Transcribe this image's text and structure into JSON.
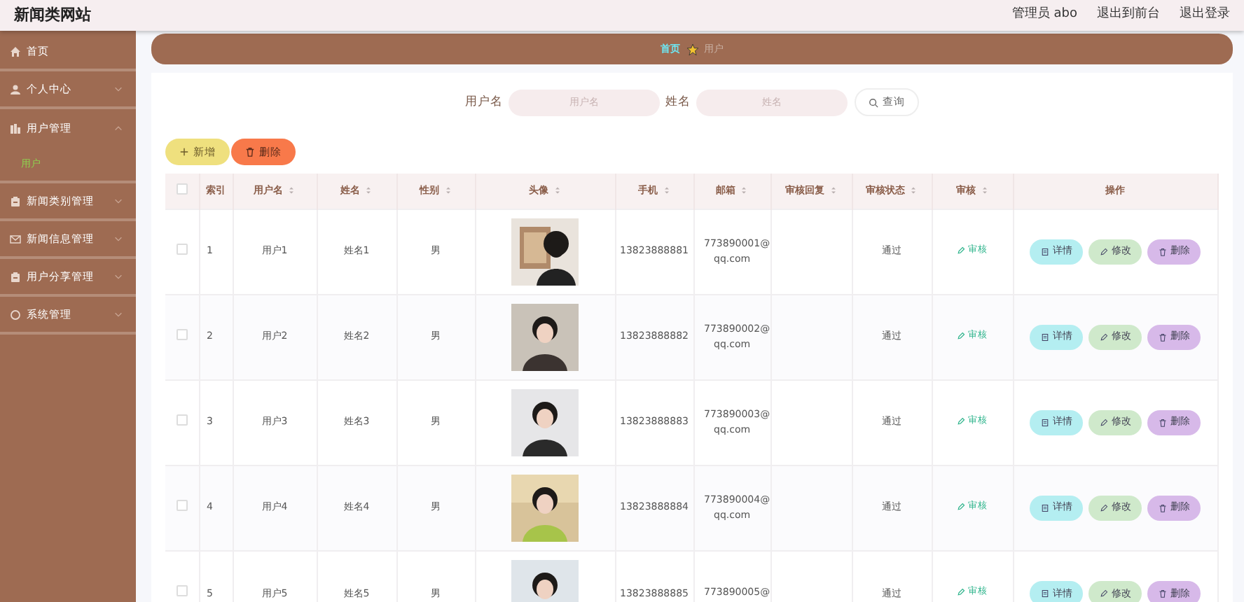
{
  "header": {
    "title": "新闻类网站",
    "links": [
      "管理员 abo",
      "退出到前台",
      "退出登录"
    ]
  },
  "sidebar": {
    "items": [
      {
        "label": "首页",
        "kind": "link"
      },
      {
        "label": "个人中心",
        "kind": "menu",
        "expanded": false
      },
      {
        "label": "用户管理",
        "kind": "menu",
        "expanded": true,
        "children": [
          {
            "label": "用户",
            "selected": true
          }
        ]
      },
      {
        "label": "新闻类别管理",
        "kind": "menu",
        "expanded": false
      },
      {
        "label": "新闻信息管理",
        "kind": "menu",
        "expanded": false
      },
      {
        "label": "用户分享管理",
        "kind": "menu",
        "expanded": false
      },
      {
        "label": "系统管理",
        "kind": "menu",
        "expanded": false
      }
    ]
  },
  "breadcrumb": [
    "首页",
    "用户"
  ],
  "search": {
    "fields": [
      {
        "label": "用户名",
        "placeholder": "用户名"
      },
      {
        "label": "姓名",
        "placeholder": "姓名"
      }
    ],
    "button": "查询"
  },
  "toolbar": [
    {
      "kind": "add",
      "label": "新增"
    },
    {
      "kind": "delete",
      "label": "删除"
    }
  ],
  "table": {
    "select_all": {
      "checked": false
    },
    "columns": [
      {
        "label": "索引",
        "sortable": false
      },
      {
        "label": "用户名",
        "sortable": true
      },
      {
        "label": "姓名",
        "sortable": true
      },
      {
        "label": "性别",
        "sortable": true
      },
      {
        "label": "头像",
        "sortable": true
      },
      {
        "label": "手机",
        "sortable": true
      },
      {
        "label": "邮箱",
        "sortable": true
      },
      {
        "label": "审核回复",
        "sortable": true
      },
      {
        "label": "审核状态",
        "sortable": true
      },
      {
        "label": "审核",
        "sortable": true
      },
      {
        "label": "操作",
        "sortable": false
      }
    ],
    "rows": [
      {
        "checked": false,
        "index": "1",
        "username": "用户1",
        "name": "姓名1",
        "gender": "男",
        "avatar": {
          "kind": "picture"
        },
        "phone": "13823888881",
        "email_lines": [
          "773890001@",
          "qq.com"
        ],
        "status": "通过",
        "audit": "审核",
        "actions": [
          "详情",
          "修改",
          "删除"
        ]
      },
      {
        "checked": false,
        "index": "2",
        "username": "用户2",
        "name": "姓名2",
        "gender": "男",
        "avatar": {
          "kind": "picture"
        },
        "phone": "13823888882",
        "email_lines": [
          "773890002@",
          "qq.com"
        ],
        "status": "通过",
        "audit": "审核",
        "actions": [
          "详情",
          "修改",
          "删除"
        ]
      },
      {
        "checked": false,
        "index": "3",
        "username": "用户3",
        "name": "姓名3",
        "gender": "男",
        "avatar": {
          "kind": "picture"
        },
        "phone": "13823888883",
        "email_lines": [
          "773890003@",
          "qq.com"
        ],
        "status": "通过",
        "audit": "审核",
        "actions": [
          "详情",
          "修改",
          "删除"
        ]
      },
      {
        "checked": false,
        "index": "4",
        "username": "用户4",
        "name": "姓名4",
        "gender": "男",
        "avatar": {
          "kind": "picture"
        },
        "phone": "13823888884",
        "email_lines": [
          "773890004@",
          "qq.com"
        ],
        "status": "通过",
        "audit": "审核",
        "actions": [
          "详情",
          "修改",
          "删除"
        ]
      },
      {
        "checked": false,
        "index": "5",
        "username": "用户5",
        "name": "姓名5",
        "gender": "男",
        "avatar": {
          "kind": "picture"
        },
        "phone": "13823888885",
        "email_lines": [
          "773890005@"
        ],
        "status": "通过",
        "audit": "审核",
        "actions": [
          "详情",
          "修改",
          "删除"
        ]
      }
    ]
  }
}
